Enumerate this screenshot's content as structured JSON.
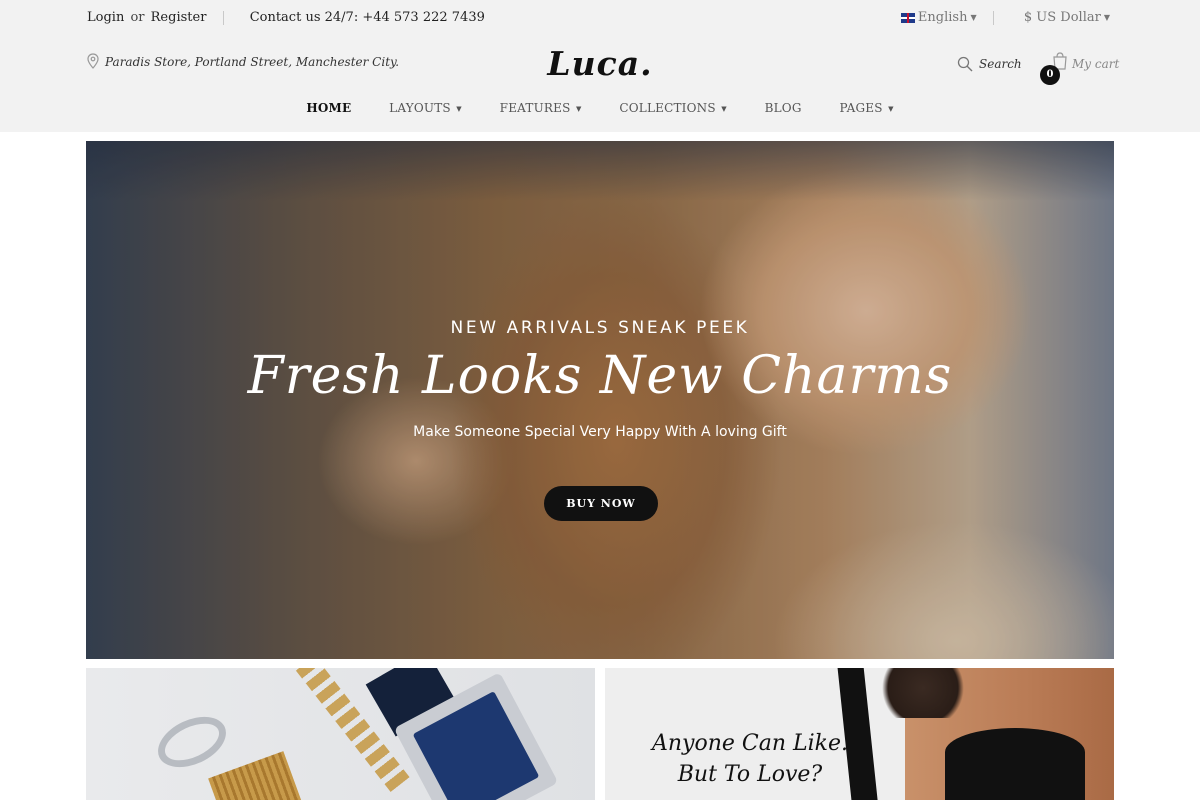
{
  "topbar": {
    "login": "Login",
    "or": "or",
    "register": "Register",
    "contact": "Contact us 24/7: +44 573 222 7439",
    "language": "English",
    "currency": "$ US Dollar"
  },
  "header": {
    "address": "Paradis Store, Portland Street, Manchester City.",
    "logo": "Luca.",
    "search_label": "Search",
    "cart_label": "My cart",
    "cart_count": "0"
  },
  "nav": {
    "items": [
      {
        "label": "HOME",
        "has_dropdown": false,
        "active": true
      },
      {
        "label": "LAYOUTS",
        "has_dropdown": true
      },
      {
        "label": "FEATURES",
        "has_dropdown": true
      },
      {
        "label": "COLLECTIONS",
        "has_dropdown": true
      },
      {
        "label": "BLOG",
        "has_dropdown": false
      },
      {
        "label": "PAGES",
        "has_dropdown": true
      }
    ]
  },
  "hero": {
    "subtitle": "NEW ARRIVALS SNEAK PEEK",
    "title": "Fresh Looks New Charms",
    "description": "Make Someone Special Very Happy With A loving Gift",
    "button": "BUY NOW"
  },
  "banners": {
    "right_quote_line1": "Anyone Can Like.",
    "right_quote_line2": "But To Love?"
  },
  "icons": {
    "location": "map-pin-icon",
    "search": "search-icon",
    "cart": "shopping-bag-icon",
    "flag": "uk-flag-icon"
  },
  "colors": {
    "header_bg": "#f2f2f2",
    "button_bg": "#111111",
    "text_dark": "#222222"
  }
}
